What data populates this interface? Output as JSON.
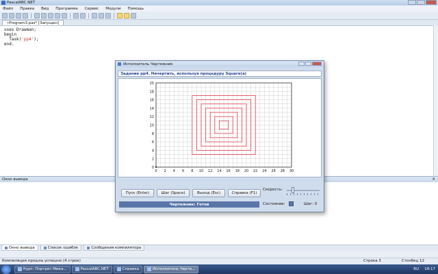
{
  "ide": {
    "title": "PascalABC.NET",
    "menu": [
      "Файл",
      "Правка",
      "Вид",
      "Программа",
      "Сервис",
      "Модули",
      "Помощь"
    ],
    "tab": "•Program3.pas* [Запущен]",
    "code": [
      {
        "pre": "uses Drawman;",
        "str": "",
        "post": ""
      },
      {
        "pre": "begin",
        "str": "",
        "post": ""
      },
      {
        "pre": "  Task(",
        "str": "'pp4'",
        "post": ");"
      },
      {
        "pre": "end.",
        "str": "",
        "post": ""
      }
    ],
    "output_title": "Окно вывода",
    "bottom_tabs": [
      "Окно вывода",
      "Список ошибок",
      "Сообщения компилятора"
    ],
    "status": "Компиляция прошла успешно (4 строк)",
    "row_label": "Строка 3",
    "col_label": "Столбец 12"
  },
  "dialog": {
    "title": "Исполнитель Чертежник",
    "task": "Задание pp4. Начертить, используя процедуру Square(a)",
    "buttons": [
      "Пуск (Enter)",
      "Шаг (Space)",
      "Выход (Esc)",
      "Справка (F1)"
    ],
    "speed_label": "Скорость:",
    "speed_level": 0.15,
    "state_label": "Состояние:",
    "state_text": "Чертежник: Готов",
    "step_text": "Шаг: 0"
  },
  "plot": {
    "x_ticks": [
      0,
      2,
      4,
      6,
      8,
      10,
      12,
      14,
      16,
      18,
      20,
      22,
      24,
      26,
      28,
      30
    ],
    "y_ticks": [
      0,
      2,
      4,
      6,
      8,
      10,
      12,
      14,
      16,
      18,
      20
    ],
    "grid_line_color": "#cfcfcf",
    "square_color": "#e0394a",
    "center": [
      15,
      10
    ],
    "squares": [
      2,
      4,
      6,
      8,
      10,
      12,
      14
    ]
  },
  "taskbar": {
    "items": [
      "Курс: Портрет Мика...",
      "PascalABC.NET",
      "Справка",
      "Исполнитель Черте..."
    ],
    "lang": "RU",
    "time": "18:17"
  }
}
